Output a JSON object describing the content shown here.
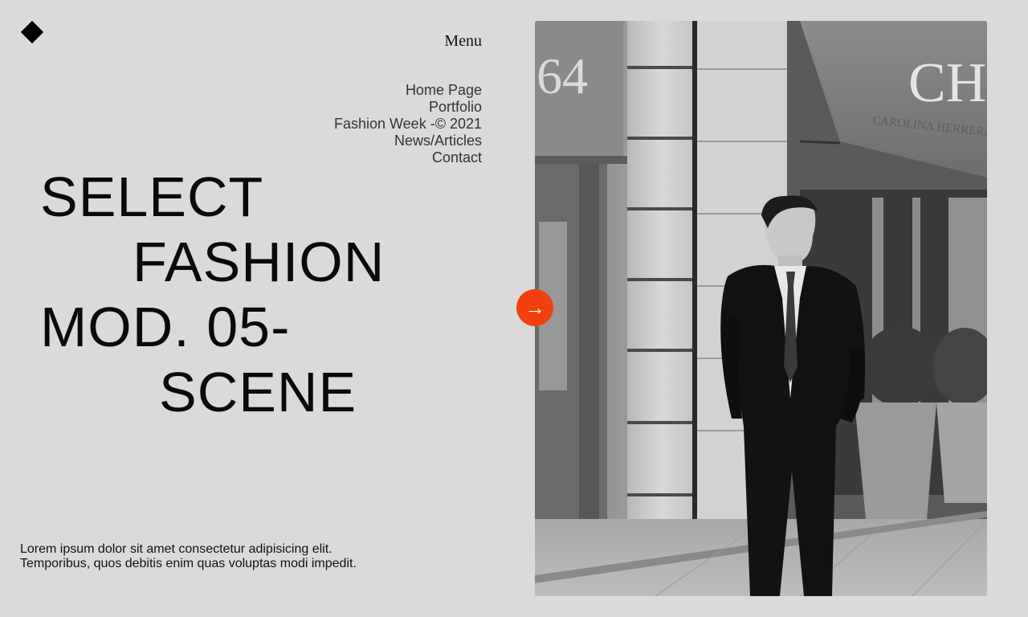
{
  "header": {
    "logo_icon": "diamond-icon",
    "menu_label": "Menu"
  },
  "nav": {
    "items": [
      {
        "label": "Home Page"
      },
      {
        "label": "Portfolio"
      },
      {
        "label": "Fashion Week -© 2021"
      },
      {
        "label": "News/Articles"
      },
      {
        "label": "Contact"
      }
    ]
  },
  "hero": {
    "lines": [
      "SELECT",
      "FASHION",
      "MOD. 05-",
      "SCENE"
    ],
    "blurb_line1": "Lorem ipsum dolor sit amet consectetur adipisicing elit.",
    "blurb_line2": "Temporibus, quos debitis enim quas voluptas modi impedit."
  },
  "photo": {
    "storefront_sign_letters": "CH",
    "awning_text": "CAROLINA HERRERA"
  },
  "next_button": {
    "icon": "arrow-right-icon",
    "glyph": "→",
    "color": "#f2400f"
  },
  "colors": {
    "background": "#dadada",
    "accent": "#f2400f",
    "text": "#111111"
  }
}
